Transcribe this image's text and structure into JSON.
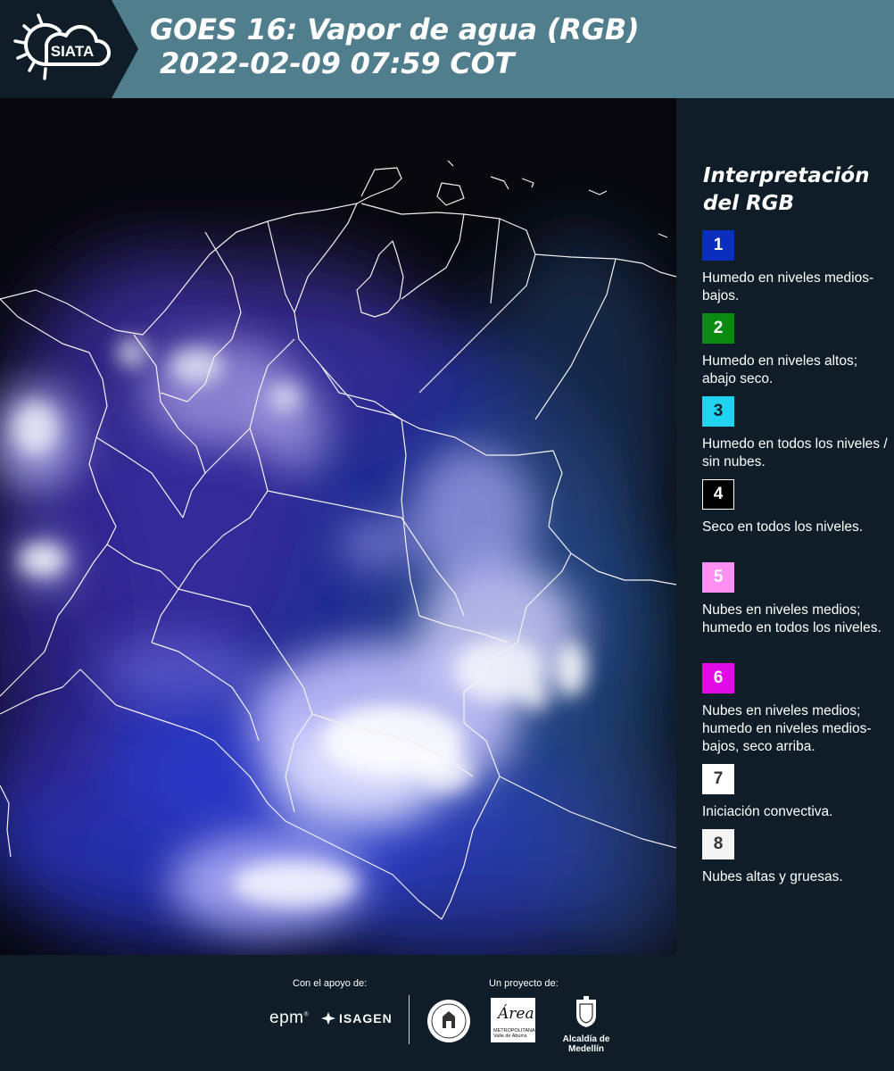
{
  "header": {
    "brand": "SIATA",
    "title": "GOES 16: Vapor de agua (RGB)\n 2022-02-09 07:59 COT"
  },
  "legend": {
    "title": "Interpretación\ndel RGB",
    "items": [
      {
        "number": "1",
        "color": "#0a2fbf",
        "text_color": "#ffffff",
        "border": "#0a2fbf",
        "description": "Humedo en niveles medios-bajos."
      },
      {
        "number": "2",
        "color": "#0b8a12",
        "text_color": "#ffffff",
        "border": "#0b8a12",
        "description": "Humedo en niveles altos; abajo seco."
      },
      {
        "number": "3",
        "color": "#22d3f0",
        "text_color": "#0e1d27",
        "border": "#22d3f0",
        "description": "Humedo en todos los niveles / sin nubes."
      },
      {
        "number": "4",
        "color": "#000000",
        "text_color": "#ffffff",
        "border": "#ffffff",
        "description": "Seco en todos los niveles."
      },
      {
        "number": "5",
        "color": "#ff8ff0",
        "text_color": "#ffffff",
        "border": "#ff8ff0",
        "description": "Nubes en niveles medios; humedo en todos los niveles."
      },
      {
        "number": "6",
        "color": "#e30ae8",
        "text_color": "#ffffff",
        "border": "#e30ae8",
        "description": "Nubes en niveles medios; humedo en niveles medios-bajos, seco arriba."
      },
      {
        "number": "7",
        "color": "#ffffff",
        "text_color": "#333333",
        "border": "#ffffff",
        "description": "Iniciación convectiva."
      },
      {
        "number": "8",
        "color": "#f4f4f4",
        "text_color": "#333333",
        "border": "#f4f4f4",
        "description": "Nubes altas y gruesas."
      }
    ]
  },
  "footer": {
    "support_label": "Con el apoyo de:",
    "project_label": "Un proyecto de:",
    "sponsors": {
      "epm": "epm",
      "isagen": "ISAGEN",
      "area_word": "Área",
      "area_sub": "METROPOLITANA\nValle de Aburrá",
      "alcaldia": "Alcaldía de Medellín"
    }
  },
  "icons": {
    "logo": "siata-sun-cloud-icon",
    "seal": "university-seal-icon",
    "crest": "medellin-crest-icon"
  },
  "colors": {
    "header_bg": "#517e8d",
    "panel_bg": "#0e1d27",
    "map_dark": "#07070c",
    "moist_blue": "#2a3fd0",
    "cloud_white": "#eef0ff"
  }
}
